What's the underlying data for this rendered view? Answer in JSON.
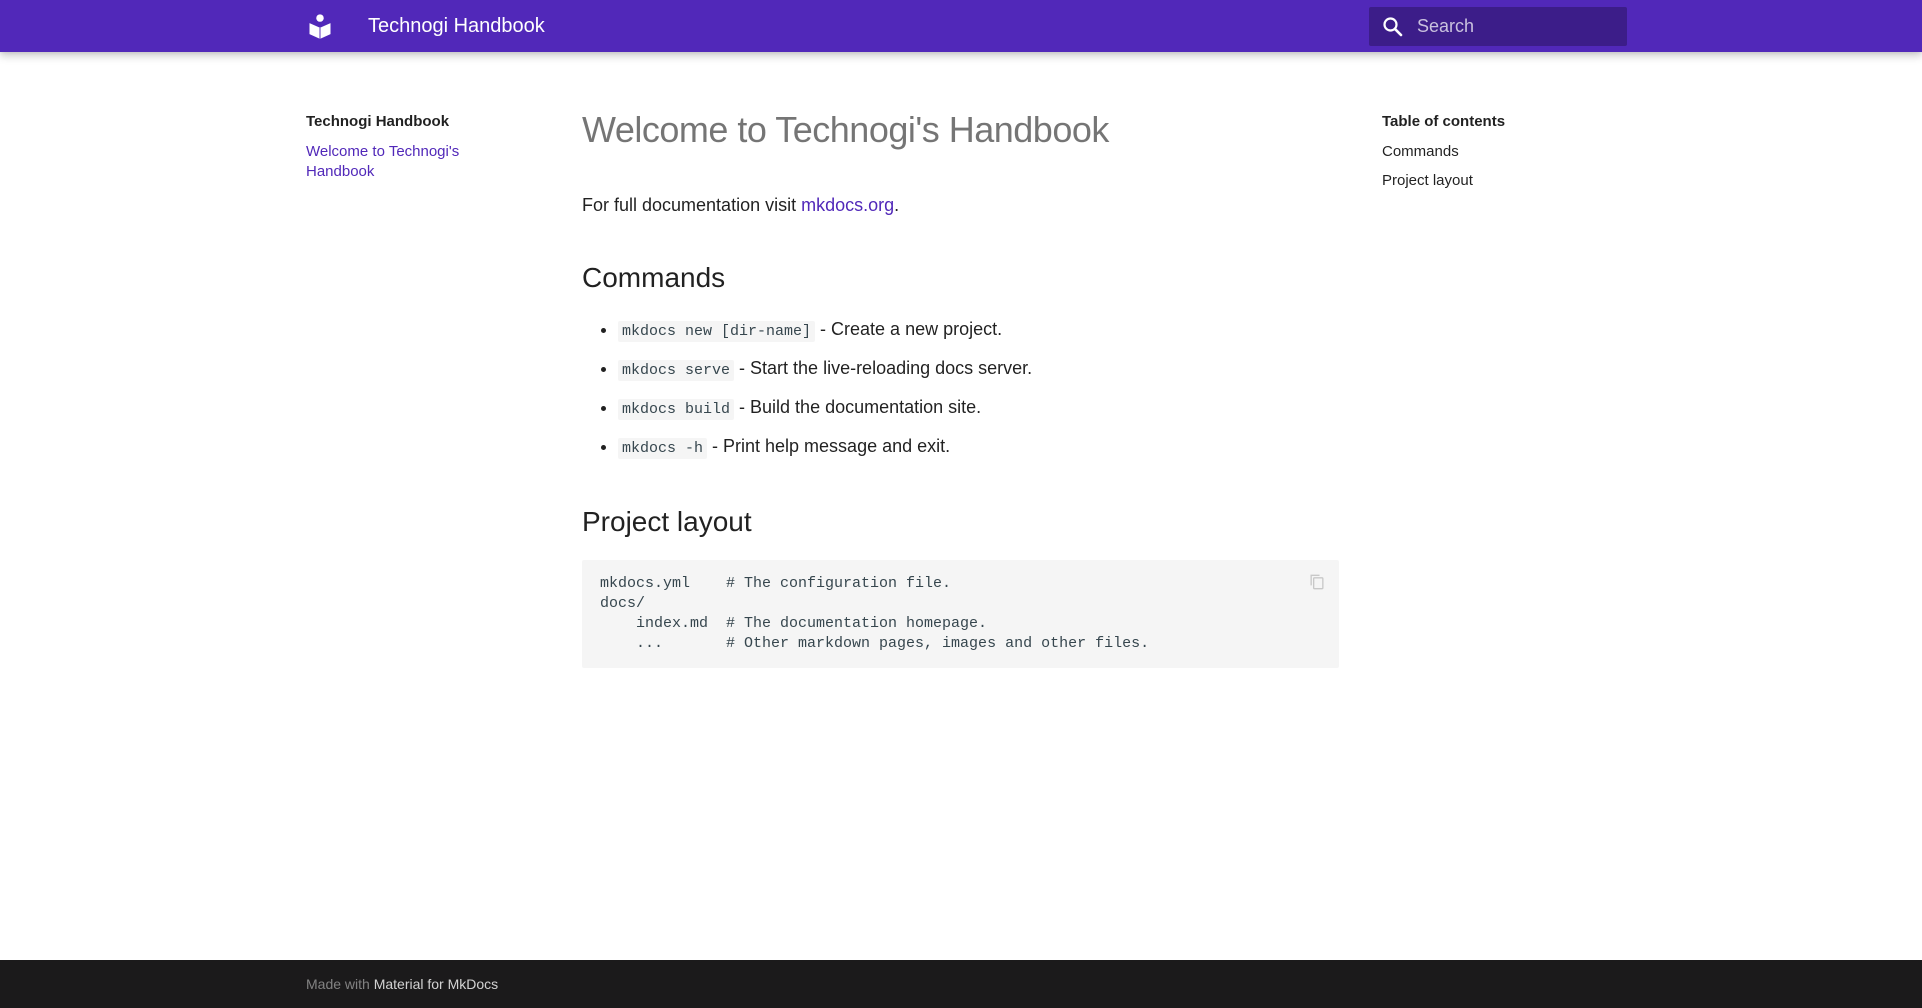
{
  "header": {
    "title": "Technogi Handbook",
    "logo_icon": "book-reader-icon",
    "search_placeholder": "Search",
    "background": "#5128b9"
  },
  "sidebar": {
    "title": "Technogi Handbook",
    "items": [
      {
        "label": "Welcome to Technogi's Handbook"
      }
    ]
  },
  "toc": {
    "title": "Table of contents",
    "items": [
      {
        "label": "Commands"
      },
      {
        "label": "Project layout"
      }
    ]
  },
  "main": {
    "title": "Welcome to Technogi's Handbook",
    "intro_prefix": "For full documentation visit ",
    "intro_link": "mkdocs.org",
    "intro_suffix": ".",
    "commands_heading": "Commands",
    "commands": [
      {
        "code": "mkdocs new [dir-name]",
        "desc": " - Create a new project."
      },
      {
        "code": "mkdocs serve",
        "desc": " - Start the live-reloading docs server."
      },
      {
        "code": "mkdocs build",
        "desc": " - Build the documentation site."
      },
      {
        "code": "mkdocs -h",
        "desc": " - Print help message and exit."
      }
    ],
    "layout_heading": "Project layout",
    "layout_code": "mkdocs.yml    # The configuration file.\ndocs/\n    index.md  # The documentation homepage.\n    ...       # Other markdown pages, images and other files."
  },
  "footer": {
    "prefix": "Made with ",
    "link": "Material for MkDocs"
  }
}
